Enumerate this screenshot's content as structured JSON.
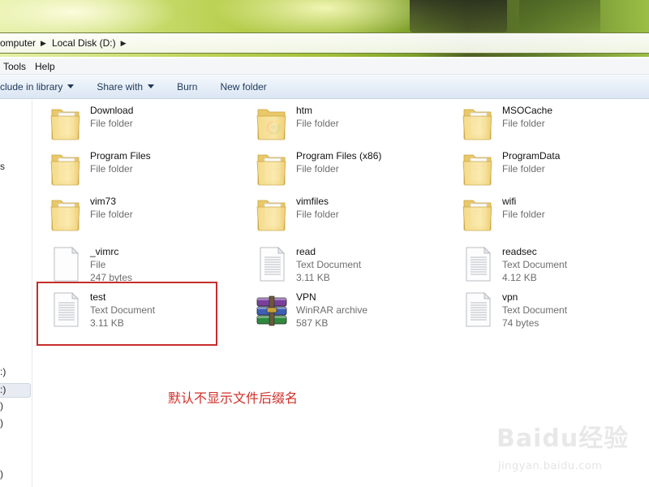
{
  "breadcrumb": {
    "computer": "omputer",
    "disk": "Local Disk (D:)"
  },
  "menu": {
    "tools": "Tools",
    "help": "Help"
  },
  "toolbar": {
    "include": "clude in library",
    "share": "Share with",
    "burn": "Burn",
    "new_folder": "New folder"
  },
  "nav_fragments": {
    "f1": "s",
    "f2": ":)",
    "f3": ":)",
    "f4": ")",
    "f5": ")",
    "f6": ")"
  },
  "items": [
    {
      "name": "Download",
      "type": "File folder",
      "size": "",
      "icon": "folder-icon"
    },
    {
      "name": "htm",
      "type": "File folder",
      "size": "",
      "icon": "chrome-folder-icon"
    },
    {
      "name": "MSOCache",
      "type": "File folder",
      "size": "",
      "icon": "folder-icon"
    },
    {
      "name": "Program Files",
      "type": "File folder",
      "size": "",
      "icon": "folder-icon"
    },
    {
      "name": "Program Files (x86)",
      "type": "File folder",
      "size": "",
      "icon": "folder-icon"
    },
    {
      "name": "ProgramData",
      "type": "File folder",
      "size": "",
      "icon": "folder-icon"
    },
    {
      "name": "vim73",
      "type": "File folder",
      "size": "",
      "icon": "folder-icon"
    },
    {
      "name": "vimfiles",
      "type": "File folder",
      "size": "",
      "icon": "folder-icon"
    },
    {
      "name": "wifi",
      "type": "File folder",
      "size": "",
      "icon": "folder-icon"
    },
    {
      "name": "_vimrc",
      "type": "File",
      "size": "247 bytes",
      "icon": "blank-file-icon"
    },
    {
      "name": "read",
      "type": "Text Document",
      "size": "3.11 KB",
      "icon": "text-document-icon"
    },
    {
      "name": "readsec",
      "type": "Text Document",
      "size": "4.12 KB",
      "icon": "text-document-icon"
    },
    {
      "name": "test",
      "type": "Text Document",
      "size": "3.11 KB",
      "icon": "text-document-icon"
    },
    {
      "name": "VPN",
      "type": "WinRAR archive",
      "size": "587 KB",
      "icon": "winrar-archive-icon"
    },
    {
      "name": "vpn",
      "type": "Text Document",
      "size": "74 bytes",
      "icon": "text-document-icon"
    }
  ],
  "annotation": "默认不显示文件后缀名",
  "watermark": {
    "logo": "Baidu经验",
    "url": "jingyan.baidu.com"
  },
  "colors": {
    "highlight_border": "#c62d2d",
    "annotation_text": "#d0302a",
    "toolbar_text": "#1e395b"
  }
}
